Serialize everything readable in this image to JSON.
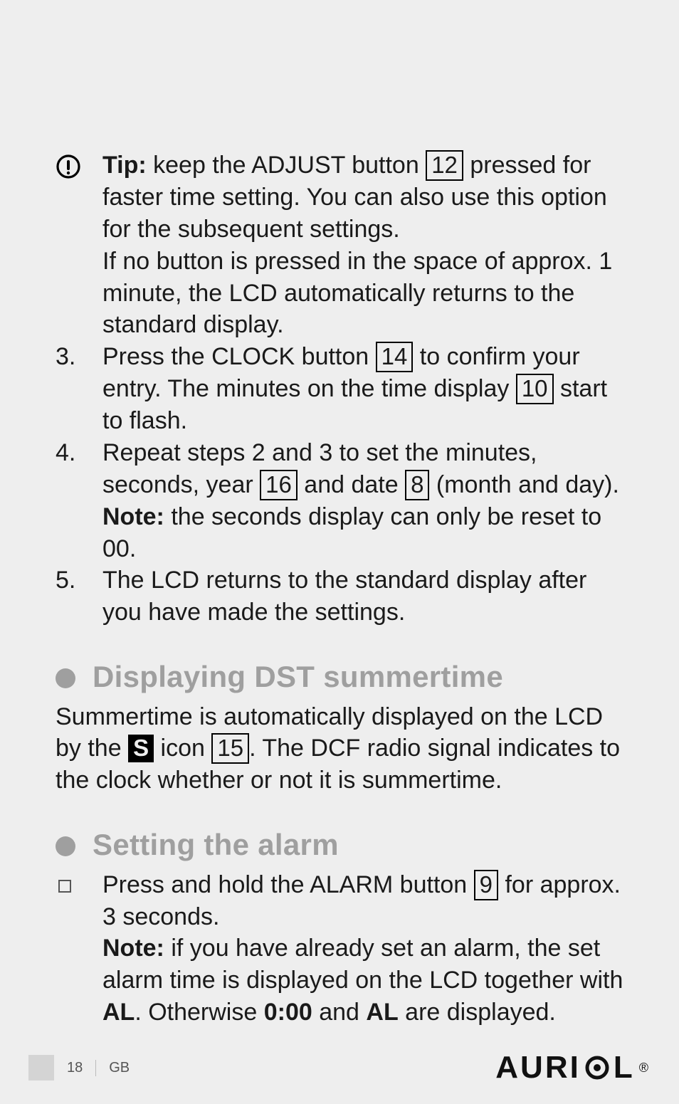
{
  "tip": {
    "label": "Tip:",
    "part1": " keep the ADJUST button ",
    "key1": "12",
    "part2": " pressed for faster time setting. You can also use this option for the subsequent settings.",
    "part3": "If no button is pressed in the space of approx. 1 minute, the LCD automatically returns to the standard display."
  },
  "step3": {
    "num": "3.",
    "part1": "Press the CLOCK button ",
    "key1": "14",
    "part2": " to confirm your entry. The minutes on the time display ",
    "key2": "10",
    "part3": " start to flash."
  },
  "step4": {
    "num": "4.",
    "part1": "Repeat steps 2 and 3 to set the minutes, seconds, year ",
    "key1": "16",
    "part2": " and date ",
    "key2": "8",
    "part3": " (month and day).",
    "note_label": "Note:",
    "note_text": " the seconds display can only be reset to 00."
  },
  "step5": {
    "num": "5.",
    "text": "The LCD returns to the standard display after you have made the settings."
  },
  "dst": {
    "title": "Displaying DST summertime",
    "part1": "Summertime is automatically displayed on the LCD by the ",
    "s_label": "S",
    "part2": " icon ",
    "key1": "15",
    "part3": ". The DCF radio signal indicates to the clock whether or not it is summertime."
  },
  "alarm": {
    "title": "Setting the alarm",
    "part1": "Press and hold the ALARM button ",
    "key1": "9",
    "part2": " for approx. 3 seconds.",
    "note_label": "Note:",
    "note_part1": " if you have already set an alarm, the set alarm time is displayed on the LCD together with ",
    "al1": "AL",
    "note_part2": ". Otherwise ",
    "zero": "0:00",
    "note_part3": " and ",
    "al2": "AL",
    "note_part4": " are displayed."
  },
  "footer": {
    "page": "18",
    "region": "GB",
    "brand": "AURI",
    "brand2": "L"
  }
}
